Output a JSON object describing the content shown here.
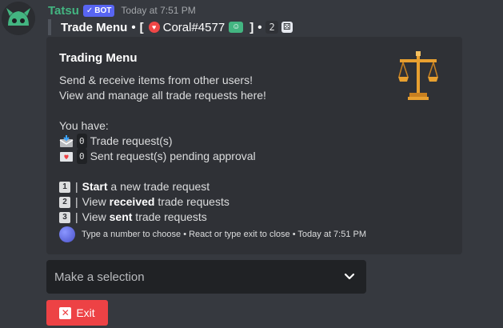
{
  "message": {
    "username": "Tatsu",
    "bot_tag": "BOT",
    "timestamp": "Today at 7:51 PM",
    "trade_line": {
      "title": "Trade Menu",
      "bullet": "•",
      "open_bracket": "[",
      "user": "Coral#4577",
      "close_bracket": "]",
      "count": "2"
    }
  },
  "embed": {
    "title": "Trading Menu",
    "desc_line1": "Send & receive items from other users!",
    "desc_line2": "View and manage all trade requests here!",
    "you_have": "You have:",
    "trade_count": "0",
    "trade_label": "Trade request(s)",
    "sent_count": "0",
    "sent_label": "Sent request(s) pending approval",
    "options": [
      {
        "key": "1",
        "pre": "",
        "bold": "Start",
        "post": " a new trade request"
      },
      {
        "key": "2",
        "pre": "View ",
        "bold": "received",
        "post": " trade requests"
      },
      {
        "key": "3",
        "pre": "View ",
        "bold": "sent",
        "post": " trade requests"
      }
    ],
    "footer": "Type a number to choose • React or type exit to close • Today at 7:51 PM"
  },
  "select": {
    "placeholder": "Make a selection"
  },
  "exit_button": {
    "label": "Exit"
  },
  "colors": {
    "background": "#36393f",
    "embed_bg": "#2f3136",
    "username": "#43b581",
    "bot_tag": "#5865f2",
    "exit_button": "#ed4245"
  }
}
